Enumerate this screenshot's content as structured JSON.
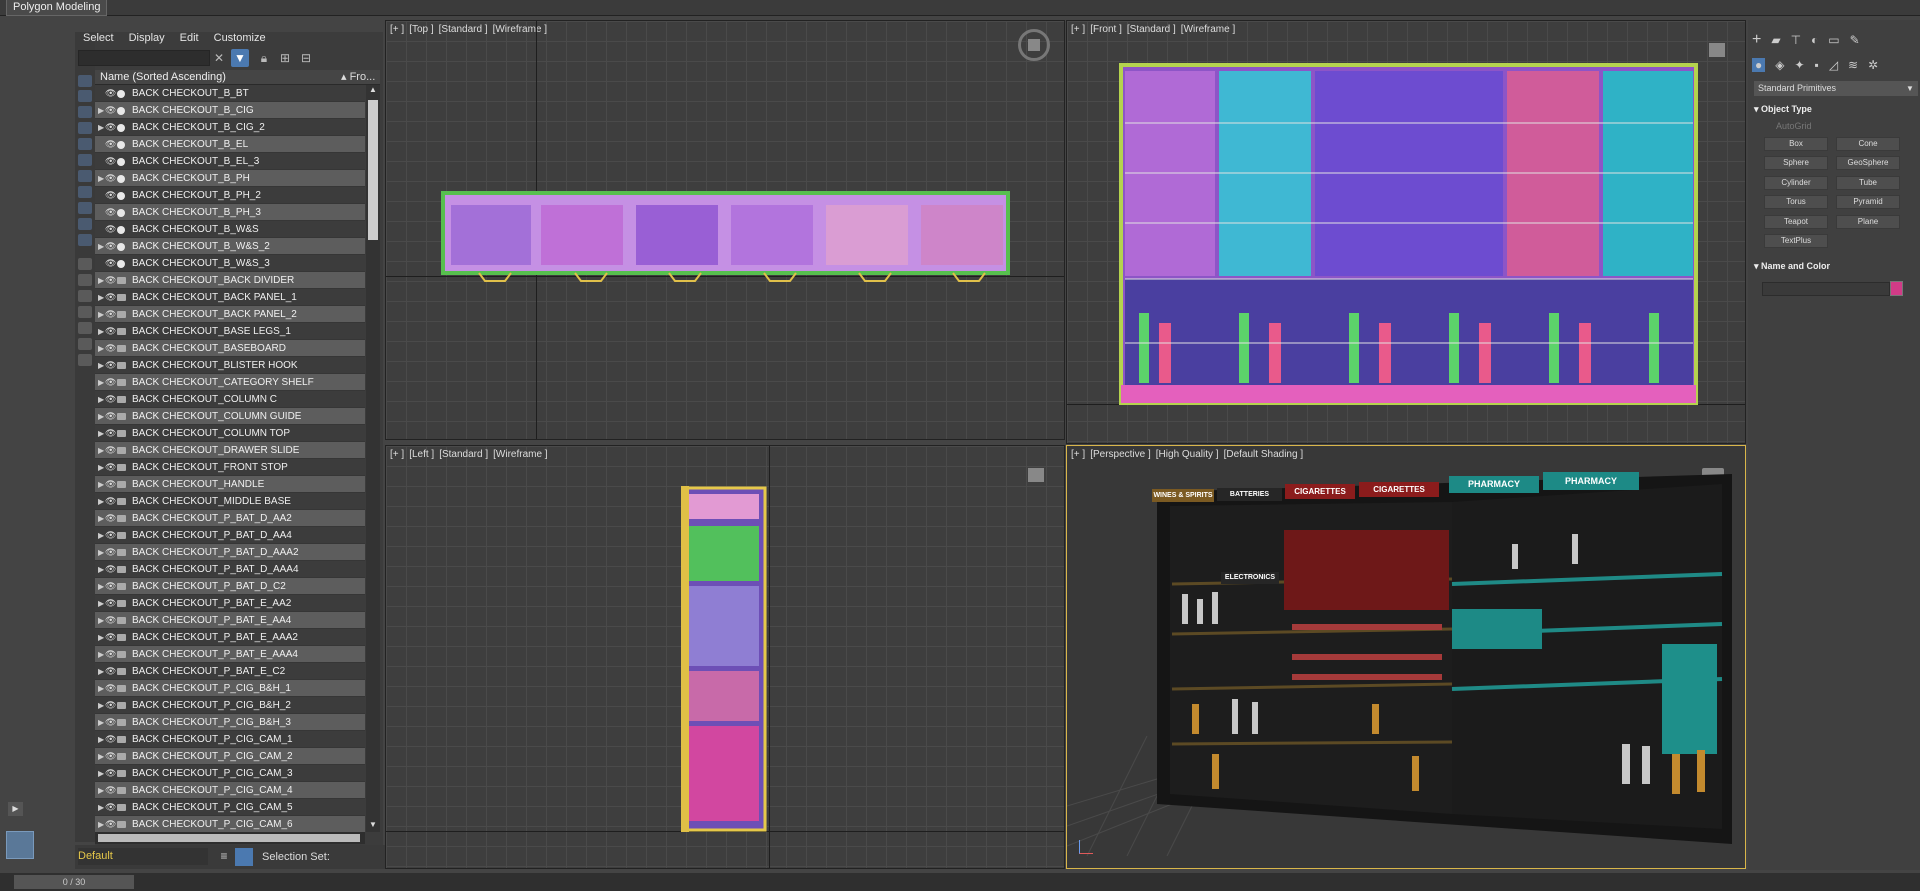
{
  "window": {
    "title": "Polygon Modeling"
  },
  "menu": [
    "Select",
    "Display",
    "Edit",
    "Customize"
  ],
  "explorer": {
    "column_name": "Name (Sorted Ascending)",
    "column_from": "▴ Fro...",
    "rows": [
      "BACK CHECKOUT_B_BT",
      "BACK CHECKOUT_B_CIG",
      "BACK CHECKOUT_B_CIG_2",
      "BACK CHECKOUT_B_EL",
      "BACK CHECKOUT_B_EL_3",
      "BACK CHECKOUT_B_PH",
      "BACK CHECKOUT_B_PH_2",
      "BACK CHECKOUT_B_PH_3",
      "BACK CHECKOUT_B_W&S",
      "BACK CHECKOUT_B_W&S_2",
      "BACK CHECKOUT_B_W&S_3",
      "BACK CHECKOUT_BACK DIVIDER",
      "BACK CHECKOUT_BACK PANEL_1",
      "BACK CHECKOUT_BACK PANEL_2",
      "BACK CHECKOUT_BASE LEGS_1",
      "BACK CHECKOUT_BASEBOARD",
      "BACK CHECKOUT_BLISTER HOOK",
      "BACK CHECKOUT_CATEGORY SHELF",
      "BACK CHECKOUT_COLUMN C",
      "BACK CHECKOUT_COLUMN GUIDE",
      "BACK CHECKOUT_COLUMN TOP",
      "BACK CHECKOUT_DRAWER SLIDE",
      "BACK CHECKOUT_FRONT STOP",
      "BACK CHECKOUT_HANDLE",
      "BACK CHECKOUT_MIDDLE BASE",
      "BACK CHECKOUT_P_BAT_D_AA2",
      "BACK CHECKOUT_P_BAT_D_AA4",
      "BACK CHECKOUT_P_BAT_D_AAA2",
      "BACK CHECKOUT_P_BAT_D_AAA4",
      "BACK CHECKOUT_P_BAT_D_C2",
      "BACK CHECKOUT_P_BAT_E_AA2",
      "BACK CHECKOUT_P_BAT_E_AA4",
      "BACK CHECKOUT_P_BAT_E_AAA2",
      "BACK CHECKOUT_P_BAT_E_AAA4",
      "BACK CHECKOUT_P_BAT_E_C2",
      "BACK CHECKOUT_P_CIG_B&H_1",
      "BACK CHECKOUT_P_CIG_B&H_2",
      "BACK CHECKOUT_P_CIG_B&H_3",
      "BACK CHECKOUT_P_CIG_CAM_1",
      "BACK CHECKOUT_P_CIG_CAM_2",
      "BACK CHECKOUT_P_CIG_CAM_3",
      "BACK CHECKOUT_P_CIG_CAM_4",
      "BACK CHECKOUT_P_CIG_CAM_5",
      "BACK CHECKOUT_P_CIG_CAM_6"
    ],
    "layer": "Default",
    "selection_set_label": "Selection Set:"
  },
  "viewports": {
    "top": {
      "plus": "[+ ]",
      "view": "[Top ]",
      "mode": "[Standard ]",
      "shading": "[Wireframe ]"
    },
    "front": {
      "plus": "[+ ]",
      "view": "[Front ]",
      "mode": "[Standard ]",
      "shading": "[Wireframe ]"
    },
    "left": {
      "plus": "[+ ]",
      "view": "[Left ]",
      "mode": "[Standard ]",
      "shading": "[Wireframe ]"
    },
    "persp": {
      "plus": "[+ ]",
      "view": "[Perspective ]",
      "mode": "[High Quality ]",
      "shading": "[Default Shading ]"
    }
  },
  "signs": [
    "WINES & SPIRITS",
    "BATTERIES",
    "CIGARETTES",
    "CIGARETTES",
    "PHARMACY",
    "PHARMACY",
    "ELECTRONICS"
  ],
  "command_panel": {
    "dropdown": "Standard Primitives",
    "object_type_title": "Object Type",
    "autogrid": "AutoGrid",
    "buttons": [
      "Box",
      "Cone",
      "Sphere",
      "GeoSphere",
      "Cylinder",
      "Tube",
      "Torus",
      "Pyramid",
      "Teapot",
      "Plane",
      "TextPlus"
    ],
    "name_color_title": "Name and Color",
    "accent_color": "#d13b87"
  },
  "status": {
    "frame": "0 / 30"
  }
}
